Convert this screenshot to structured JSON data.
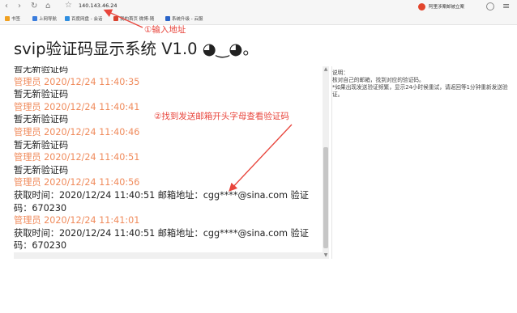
{
  "browser": {
    "url": "140.143.46.24",
    "extension_label": "阿里涉案邮被立案",
    "bookmarks": [
      {
        "label": "书签",
        "color": "#f0a020"
      },
      {
        "label": "上网导航",
        "color": "#3b7ddd"
      },
      {
        "label": "百度网盘 - 会话",
        "color": "#2f8ee0"
      },
      {
        "label": "我的首页 微博-随",
        "color": "#d9412e"
      },
      {
        "label": "系统升级 - 云服",
        "color": "#2a64c8"
      }
    ]
  },
  "annotations": {
    "step1": "①输入地址",
    "step2": "②找到发送邮箱开头字母查看验证码"
  },
  "page": {
    "title": "svip验证码显示系统 V1.0 ◕‿◕。"
  },
  "log": [
    {
      "type": "msg",
      "text": "暂无新验证码"
    },
    {
      "type": "admin",
      "text": "管理员 2020/12/24 11:40:35"
    },
    {
      "type": "msg",
      "text": "暂无新验证码"
    },
    {
      "type": "admin",
      "text": "管理员 2020/12/24 11:40:41"
    },
    {
      "type": "msg",
      "text": "暂无新验证码"
    },
    {
      "type": "admin",
      "text": "管理员 2020/12/24 11:40:46"
    },
    {
      "type": "msg",
      "text": "暂无新验证码"
    },
    {
      "type": "admin",
      "text": "管理员 2020/12/24 11:40:51"
    },
    {
      "type": "msg",
      "text": "暂无新验证码"
    },
    {
      "type": "admin",
      "text": "管理员 2020/12/24 11:40:56"
    },
    {
      "type": "msg",
      "text": "获取时间：2020/12/24 11:40:51 邮箱地址：cgg****@sina.com 验证"
    },
    {
      "type": "msg",
      "text": "码：670230"
    },
    {
      "type": "admin",
      "text": "管理员 2020/12/24 11:41:01"
    },
    {
      "type": "msg",
      "text": "获取时间：2020/12/24 11:40:51 邮箱地址：cgg****@sina.com 验证"
    },
    {
      "type": "msg",
      "text": "码：670230"
    }
  ],
  "side_note": {
    "lines": [
      "说明：",
      "核对自己的邮箱，找到对应的验证码。",
      "*如果出现发送验证频繁，显示24小时候重试，请返回等1分钟重新发送验",
      "证。"
    ]
  },
  "colors": {
    "annotation": "#e8453c",
    "admin_text": "#f08b5c"
  }
}
